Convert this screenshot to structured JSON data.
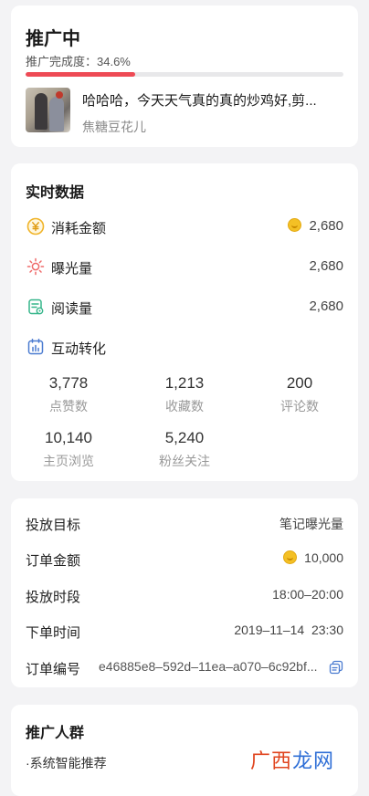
{
  "status": {
    "title": "推广中",
    "progress_text": "推广完成度：34.6%",
    "progress_fraction": 0.346,
    "note_title": "哈哈哈，今天天气真的真的炒鸡好,剪...",
    "note_author": "焦糖豆花儿"
  },
  "realtime": {
    "title": "实时数据",
    "metrics": [
      {
        "label": "消耗金额",
        "value": "2,680",
        "icon": "yuan-coin-icon",
        "has_coin": true
      },
      {
        "label": "曝光量",
        "value": "2,680",
        "icon": "sun-icon",
        "has_coin": false
      },
      {
        "label": "阅读量",
        "value": "2,680",
        "icon": "document-icon",
        "has_coin": false
      }
    ],
    "interaction": {
      "label": "互动转化",
      "icon": "calendar-chart-icon",
      "stats": [
        {
          "value": "3,778",
          "label": "点赞数"
        },
        {
          "value": "1,213",
          "label": "收藏数"
        },
        {
          "value": "200",
          "label": "评论数"
        },
        {
          "value": "10,140",
          "label": "主页浏览"
        },
        {
          "value": "5,240",
          "label": "粉丝关注"
        }
      ]
    }
  },
  "order": {
    "rows": [
      {
        "label": "投放目标",
        "value": "笔记曝光量"
      },
      {
        "label": "订单金额",
        "value": "10,000"
      },
      {
        "label": "投放时段",
        "value": "18:00–20:00"
      },
      {
        "label": "下单时间",
        "value": "2019–11–14  23:30"
      },
      {
        "label": "订单编号",
        "value": "e46885e8–592d–11ea–a070–6c92bf..."
      }
    ]
  },
  "audience": {
    "title": "推广人群",
    "item": "·系统智能推荐"
  },
  "watermark": {
    "part1": "广西",
    "part2": "龙网"
  },
  "colors": {
    "accent_red": "#ee4a55",
    "coin_yellow": "#f4c025",
    "sun_red": "#ef6a6a",
    "doc_green": "#35b58a",
    "chart_blue": "#4a7bd0"
  }
}
